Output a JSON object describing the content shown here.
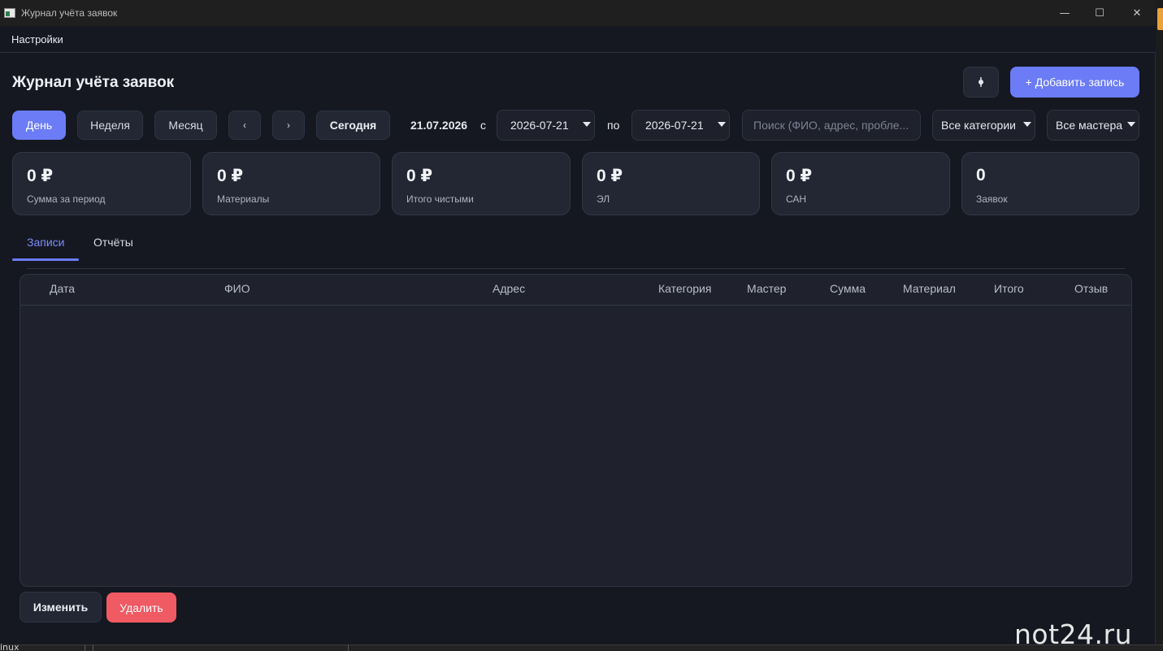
{
  "window": {
    "title": "Журнал учёта заявок",
    "controls": [
      "—",
      "☐",
      "✕"
    ]
  },
  "menu": {
    "settings": "Настройки"
  },
  "header": {
    "title": "Журнал учёта заявок",
    "theme_toggle_icon": "theme-toggle-icon",
    "add_button": "+ Добавить запись"
  },
  "period": {
    "day": "День",
    "week": "Неделя",
    "month": "Месяц",
    "prev": "‹",
    "next": "›",
    "today": "Сегодня"
  },
  "date_display": "21.07.2026",
  "range": {
    "from_label": "с",
    "from_value": "2026-07-21",
    "to_label": "по",
    "to_value": "2026-07-21"
  },
  "search": {
    "placeholder": "Поиск (ФИО, адрес, пробле..."
  },
  "filters": {
    "category": "Все категории",
    "master": "Все мастера"
  },
  "stats": [
    {
      "value": "0 ₽",
      "label": "Сумма за период"
    },
    {
      "value": "0 ₽",
      "label": "Материалы"
    },
    {
      "value": "0 ₽",
      "label": "Итого чистыми"
    },
    {
      "value": "0 ₽",
      "label": "ЭЛ"
    },
    {
      "value": "0 ₽",
      "label": "САН"
    },
    {
      "value": "0",
      "label": "Заявок"
    }
  ],
  "tabs": [
    {
      "label": "Записи",
      "active": true
    },
    {
      "label": "Отчёты",
      "active": false
    }
  ],
  "table": {
    "columns": [
      "Дата",
      "ФИО",
      "Адрес",
      "Категория",
      "Мастер",
      "Сумма",
      "Материал",
      "Итого",
      "Отзыв"
    ],
    "rows": []
  },
  "actions": {
    "edit": "Изменить",
    "delete": "Удалить"
  },
  "watermark": "not24.ru",
  "backdrop": {
    "bottom_text": "inux"
  },
  "colors": {
    "accent": "#6b7cf6",
    "danger": "#ef5a63",
    "background": "#151821",
    "card": "#232733"
  }
}
